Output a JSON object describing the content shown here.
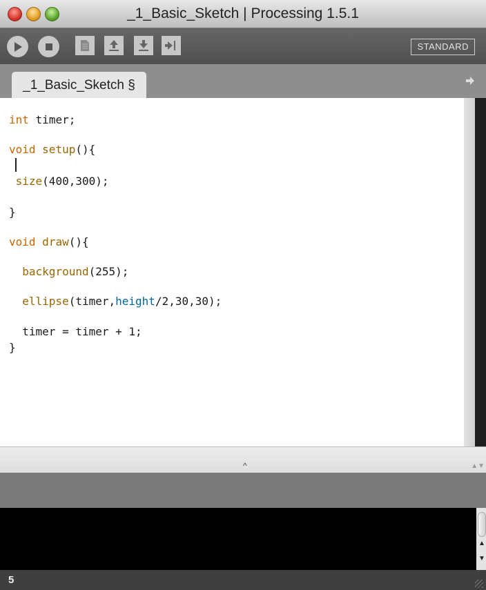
{
  "window": {
    "title": "_1_Basic_Sketch | Processing 1.5.1"
  },
  "toolbar": {
    "buttons": [
      {
        "name": "run",
        "icon": "play-icon"
      },
      {
        "name": "stop",
        "icon": "stop-icon"
      },
      {
        "name": "new",
        "icon": "new-document-icon"
      },
      {
        "name": "open",
        "icon": "open-arrow-up-icon"
      },
      {
        "name": "save",
        "icon": "save-arrow-down-icon"
      },
      {
        "name": "export",
        "icon": "export-arrow-icon"
      }
    ],
    "mode_label": "STANDARD"
  },
  "tabs": [
    {
      "label": "_1_Basic_Sketch §",
      "active": true
    }
  ],
  "editor": {
    "lines": [
      "int timer;",
      "void setup(){",
      " size(400,300);",
      "}",
      "void draw(){",
      "  background(255);",
      "  ellipse(timer,height/2,30,30);",
      "  timer = timer + 1;",
      "}"
    ]
  },
  "status": {
    "line_number": "5"
  },
  "colors": {
    "keyword": "#cc6600",
    "function": "#996600",
    "builtin_variable": "#006699",
    "toolbar_bg": "#5a5a5a",
    "console_bg": "#000000"
  }
}
